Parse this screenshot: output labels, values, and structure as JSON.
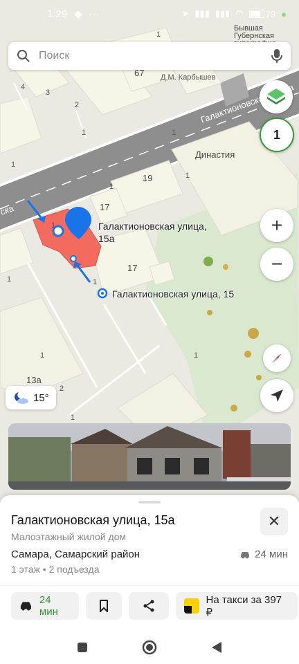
{
  "status_bar": {
    "time": "1:29",
    "battery": "79"
  },
  "search": {
    "placeholder": "Поиск"
  },
  "map": {
    "layers_count": "1",
    "labels": {
      "former_printshop": "Бывшая Губернская\nтипография",
      "karbyshev": "Д.М. Карбышев",
      "street": "Галактионовская улица",
      "street_short": "ска",
      "dinastiya": "Династия",
      "n67": "67",
      "n19": "19",
      "n17a": "17",
      "n17b": "17",
      "n13a": "13а",
      "n4": "4",
      "n3": "3",
      "n2a": "2",
      "n2b": "2",
      "n1a": "1",
      "n1b": "1",
      "n1c": "1",
      "n1d": "1",
      "n1e": "1",
      "n1f": "1",
      "n1g": "1",
      "n1h": "1",
      "n1i": "1",
      "n1j": "1",
      "n1k": "1",
      "n1l": "1"
    },
    "selected_label": "Галактионовская улица,\n15а",
    "neighbor_label": "Галактионовская улица, 15",
    "weather_temp": "15°"
  },
  "card": {
    "title": "Галактионовская улица, 15а",
    "subtitle": "Малоэтажный жилой дом",
    "city": "Самара, Самарский район",
    "drive_time": "24 мин",
    "floors": "1 этаж • 2 подъезда",
    "route_time": "24 мин",
    "taxi_label": "На такси за 397 ₽"
  },
  "colors": {
    "accent_blue": "#1a73e8",
    "building_selected": "#f26b5e",
    "route_green": "#2f9b2f",
    "taxi_yellow": "#f9d000"
  }
}
